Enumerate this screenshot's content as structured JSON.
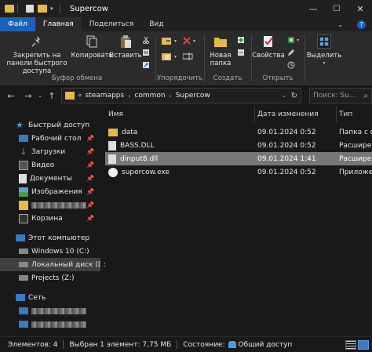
{
  "window": {
    "title": "Supercow",
    "minimize": "—",
    "maximize": "☐",
    "close": "✕"
  },
  "ribbon_tabs": [
    "Файл",
    "Главная",
    "Поделиться",
    "Вид"
  ],
  "ribbon": {
    "pin_label": "Закрепить на панели быстрого доступа",
    "copy_label": "Копировать",
    "paste_label": "Вставить",
    "clipboard_group": "Буфер обмена",
    "organize_group": "Упорядочить",
    "new_folder_label": "Новая папка",
    "create_group": "Создать",
    "properties_label": "Свойства",
    "open_group": "Открыть",
    "select_label": "Выделить"
  },
  "address": {
    "overflow": "«",
    "crumbs": [
      "steamapps",
      "common",
      "Supercow"
    ],
    "search_placeholder": "Поиск: Su..."
  },
  "nav": {
    "quick_access": "Быстрый доступ",
    "desktop": "Рабочий стол",
    "downloads": "Загрузки",
    "video": "Видео",
    "documents": "Документы",
    "images": "Изображения",
    "trash": "Корзина",
    "this_pc": "Этот компьютер",
    "drive_c": "Windows 10 (C:)",
    "drive_d": "Локальный диск (D:)",
    "drive_z": "Projects (Z:)",
    "network": "Сеть"
  },
  "columns": {
    "name": "Имя",
    "date": "Дата изменения",
    "type": "Тип"
  },
  "files": [
    {
      "name": "data",
      "date": "09.01.2024 0:52",
      "type": "Папка с ф"
    },
    {
      "name": "BASS.DLL",
      "date": "09.01.2024 0:52",
      "type": "Расширен"
    },
    {
      "name": "dinput8.dll",
      "date": "09.01.2024 1:41",
      "type": "Расширен"
    },
    {
      "name": "supercow.exe",
      "date": "09.01.2024 0:52",
      "type": "Приложен"
    }
  ],
  "status": {
    "count": "Элементов: 4",
    "selected": "Выбран 1 элемент: 7,75 МБ",
    "state_label": "Состояние:",
    "state_value": "Общий доступ"
  },
  "colors": {
    "folder": "#e8b84a",
    "accent": "#1a62b8",
    "selection": "#777777"
  }
}
